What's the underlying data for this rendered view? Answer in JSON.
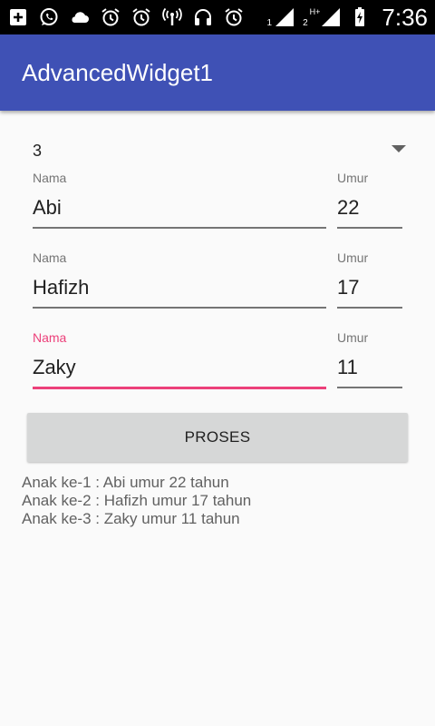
{
  "status_bar": {
    "icons": [
      "add-box-icon",
      "whatsapp-icon",
      "cloud-icon",
      "alarm-icon",
      "alarm-icon",
      "wireless-tower-icon",
      "headset-icon",
      "alarm-icon",
      "signal-icon",
      "signal-icon",
      "battery-icon"
    ],
    "sim1_label": "1",
    "sim2_label": "2",
    "network_label": "H+",
    "time": "7:36"
  },
  "app_bar": {
    "title": "AdvancedWidget1",
    "color": "#3f51b5"
  },
  "spinner": {
    "value": "3"
  },
  "children": [
    {
      "name_label": "Nama",
      "name_value": "Abi",
      "age_label": "Umur",
      "age_value": "22",
      "focused": false
    },
    {
      "name_label": "Nama",
      "name_value": "Hafizh",
      "age_label": "Umur",
      "age_value": "17",
      "focused": false
    },
    {
      "name_label": "Nama",
      "name_value": "Zaky",
      "age_label": "Umur",
      "age_value": "11",
      "focused": true
    }
  ],
  "button": {
    "label": "PROSES"
  },
  "result": [
    "Anak ke-1 : Abi umur 22 tahun",
    "Anak ke-2 : Hafizh umur 17 tahun",
    "Anak ke-3 : Zaky umur 11 tahun"
  ],
  "colors": {
    "accent": "#ec407a",
    "primary": "#3f51b5",
    "button": "#d6d7d7"
  }
}
